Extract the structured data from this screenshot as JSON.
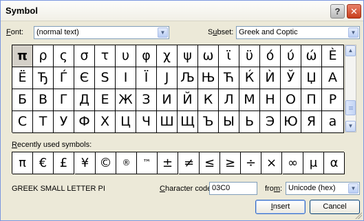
{
  "window": {
    "title": "Symbol",
    "help_label": "?",
    "close_label": "✕"
  },
  "font": {
    "label_accel": "F",
    "label_rest": "ont:",
    "value": "(normal text)"
  },
  "subset": {
    "label_pre": "S",
    "label_accel": "u",
    "label_rest": "bset:",
    "value": "Greek and Coptic"
  },
  "grid": {
    "rows": [
      [
        "π",
        "ρ",
        "ς",
        "σ",
        "τ",
        "υ",
        "φ",
        "χ",
        "ψ",
        "ω",
        "ϊ",
        "ϋ",
        "ό",
        "ύ",
        "ώ",
        "È"
      ],
      [
        "Ë",
        "Ђ",
        "Ѓ",
        "Є",
        "S",
        "І",
        "Ї",
        "J",
        "Љ",
        "Њ",
        "Ћ",
        "Ќ",
        "Ѝ",
        "Ў",
        "Џ",
        "А"
      ],
      [
        "Б",
        "В",
        "Г",
        "Д",
        "Е",
        "Ж",
        "З",
        "И",
        "Й",
        "К",
        "Л",
        "М",
        "Н",
        "О",
        "П",
        "Р"
      ],
      [
        "С",
        "Т",
        "У",
        "Ф",
        "Х",
        "Ц",
        "Ч",
        "Ш",
        "Щ",
        "Ъ",
        "Ы",
        "Ь",
        "Э",
        "Ю",
        "Я",
        "а"
      ]
    ],
    "selected": "π"
  },
  "recent": {
    "label_accel": "R",
    "label_rest": "ecently used symbols:",
    "symbols": [
      "π",
      "€",
      "£",
      "¥",
      "©",
      "®",
      "™",
      "±",
      "≠",
      "≤",
      "≥",
      "÷",
      "×",
      "∞",
      "μ",
      "α"
    ]
  },
  "status": {
    "char_name": "GREEK SMALL LETTER PI",
    "code_label_accel": "C",
    "code_label_rest": "haracter code:",
    "code_value": "03C0",
    "from_label_pre": "fro",
    "from_label_accel": "m",
    "from_label_rest": ":",
    "from_value": "Unicode (hex)"
  },
  "buttons": {
    "insert_accel": "I",
    "insert_rest": "nsert",
    "cancel": "Cancel"
  },
  "icons": {
    "dropdown": "chevron-down-icon",
    "scroll_up": "triangle-up-icon",
    "scroll_down": "triangle-down-icon"
  }
}
